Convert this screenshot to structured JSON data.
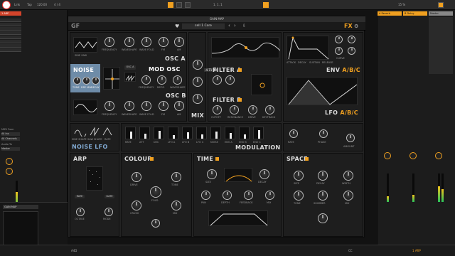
{
  "daw": {
    "transport": {
      "tempo": "120.00",
      "time_sig": "4 / 4",
      "position": "1. 1. 1",
      "cpu": "15 %",
      "key_label": "Tap",
      "link_label": "Link"
    },
    "left_track": {
      "name": "1 ARP",
      "io_label": "MIDI From",
      "io_source": "All Ins",
      "io_channel": "All Channels",
      "audio_to": "Audio To",
      "master": "Master"
    },
    "right_tracks": [
      {
        "name": "A Reverb",
        "color": "#f0a020"
      },
      {
        "name": "B Delay",
        "color": "#f0a020"
      },
      {
        "name": "Master",
        "color": "#888888"
      }
    ],
    "bottom": {
      "track": "1 ARP",
      "value": "1 ARP"
    }
  },
  "plugin": {
    "title": "GAIN MAP",
    "logo": "GF",
    "preset": "cell 1 Core",
    "fx_label": "FX",
    "sections": {
      "osc_a": "OSC A",
      "osc_b": "OSC B",
      "noise": "NOISE",
      "mod_osc": "MOD OSC",
      "mix": "MIX",
      "filter_a": "FILTER A",
      "filter_b": "FILTER B",
      "env": "ENV",
      "env_abc": "A/B/C",
      "lfo": "LFO",
      "lfo_abc": "A/B/C",
      "noise_lfo": "NOISE LFO",
      "modulation": "MODULATION",
      "arp": "ARP",
      "colour": "COLOUR",
      "time": "TIME",
      "space": "SPACE"
    },
    "osc_a_knobs": [
      "SINE SAW",
      "FREQUENCY",
      "WAVESHAPE",
      "WAVE FOLD",
      "FM",
      "AM"
    ],
    "osc_b_knobs": [
      "FREQUENCY",
      "WAVESHAPE",
      "WAVE FOLD",
      "FM",
      "AM"
    ],
    "mod_osc_knobs": [
      "FREQUENCY",
      "RATIO",
      "WAVESHAPE"
    ],
    "noise_knobs": [
      "TONE",
      "DRY MIX",
      "DECAY"
    ],
    "mix_value": "-4.71 dB",
    "filter_knobs": [
      "CUTOFF",
      "RESONANCE",
      "DRIVE",
      "KEYTRACK"
    ],
    "env_knobs": [
      "ATTACK",
      "DECAY",
      "SUSTAIN",
      "RELEASE",
      "CURVE"
    ],
    "lfo_knobs": [
      "RATE",
      "PHASE",
      "AMOUNT"
    ],
    "noise_lfo_knobs": [
      "SINE SHAPE",
      "SAW SHAPE",
      "RATE"
    ],
    "mod_steps": [
      "RATE",
      "ATT",
      "DEC",
      "LFO A",
      "LFO B",
      "LFO C",
      "NOISE",
      "ENV A",
      "ENV B",
      "ENV C"
    ],
    "mod_levels": [
      60,
      45,
      70,
      30,
      55,
      40,
      65,
      50,
      35,
      75
    ],
    "arp_knobs": [
      "RATE",
      "GATE",
      "OCTAVE",
      "MODE"
    ],
    "colour_knobs": [
      "DRIVE",
      "TONE",
      "FOLD",
      "CRUSH",
      "MIX"
    ],
    "time_knobs": [
      "SIZE",
      "DECAY",
      "PAN",
      "DEPTH",
      "FEEDBACK",
      "MIX"
    ],
    "space_knobs": [
      "SIZE",
      "DECAY",
      "WIDTH",
      "TONE",
      "SHIMMER",
      "MIX"
    ],
    "status_left": "A4D",
    "status_right": "CC"
  }
}
